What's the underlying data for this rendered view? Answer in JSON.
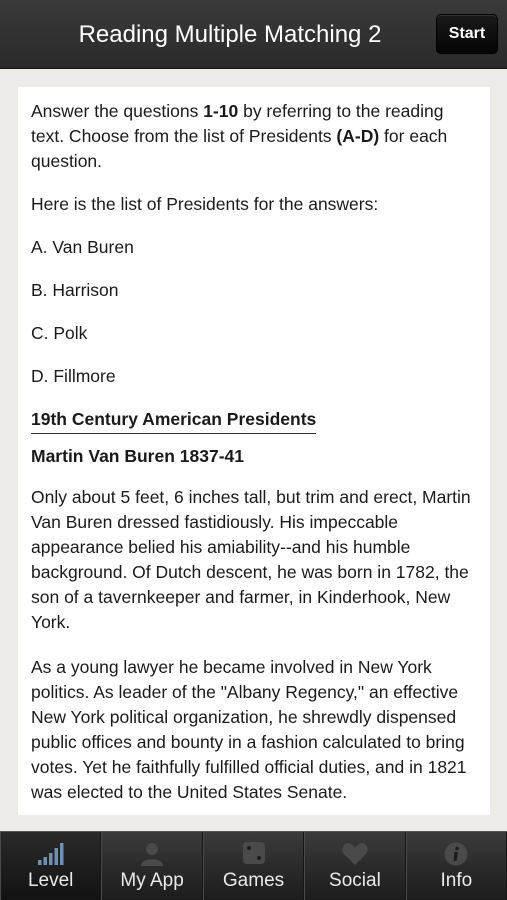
{
  "header": {
    "title": "Reading Multiple Matching 2",
    "start_label": "Start"
  },
  "content": {
    "intro_1": "Answer the questions ",
    "intro_bold_1": "1-10",
    "intro_2": " by referring to the reading text. Choose from the list of Presidents ",
    "intro_bold_2": "(A-D)",
    "intro_3": " for each question.",
    "list_intro": "Here is the list of Presidents for the answers:",
    "options": [
      "A. Van Buren",
      "B. Harrison",
      "C. Polk",
      "D. Fillmore"
    ],
    "section_title": "19th Century American Presidents",
    "president_heading": "Martin Van Buren 1837-41",
    "paragraph_1": "Only about 5 feet, 6 inches tall, but trim and erect, Martin Van Buren dressed fastidiously. His impeccable appearance belied his amiability--and his humble background. Of Dutch descent, he was born in 1782, the son of a tavernkeeper and farmer, in Kinderhook, New York.",
    "paragraph_2": "As a young lawyer he became involved in New York politics. As leader of the \"Albany Regency,\" an effective New York political organization, he shrewdly dispensed public offices and bounty in a fashion calculated to bring votes. Yet he faithfully fulfilled official duties, and in 1821 was elected to the United States Senate."
  },
  "tabs": [
    {
      "label": "Level",
      "icon": "signal-bars-icon"
    },
    {
      "label": "My App",
      "icon": "person-icon"
    },
    {
      "label": "Games",
      "icon": "dice-icon"
    },
    {
      "label": "Social",
      "icon": "heart-icon"
    },
    {
      "label": "Info",
      "icon": "info-icon"
    }
  ],
  "active_tab": "Level",
  "colors": {
    "header_bg": "#2f2f2f",
    "tab_icon": "#4a4a4a",
    "tab_icon_active": "#6f8fb5",
    "page_bg": "#ecebe8"
  }
}
